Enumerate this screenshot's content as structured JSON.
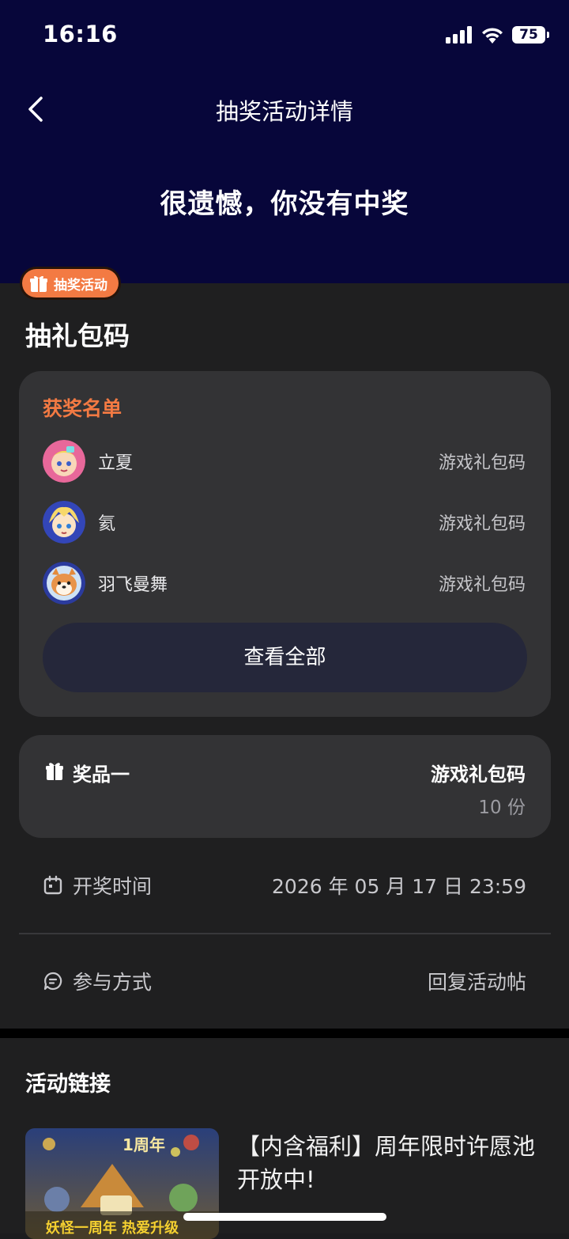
{
  "status_bar": {
    "time": "16:16",
    "battery": "75"
  },
  "nav": {
    "title": "抽奖活动详情"
  },
  "result": {
    "text": "很遗憾，你没有中奖"
  },
  "activity": {
    "tag": "抽奖活动",
    "title": "抽礼包码"
  },
  "winners": {
    "title": "获奖名单",
    "list": [
      {
        "name": "立夏",
        "prize": "游戏礼包码"
      },
      {
        "name": "氦",
        "prize": "游戏礼包码"
      },
      {
        "name": "羽飞曼舞",
        "prize": "游戏礼包码"
      }
    ],
    "view_all": "查看全部"
  },
  "prize": {
    "label": "奖品一",
    "name": "游戏礼包码",
    "count": "10 份"
  },
  "draw_time": {
    "label": "开奖时间",
    "value": "2026 年 05 月 17 日 23:59"
  },
  "participation": {
    "label": "参与方式",
    "value": "回复活动帖"
  },
  "links": {
    "title": "活动链接",
    "items": [
      {
        "title": "【内含福利】周年限时许愿池开放中!",
        "thumb_text_top": "1周年",
        "thumb_text_bottom": "妖怪一周年 热爱升级"
      }
    ]
  }
}
